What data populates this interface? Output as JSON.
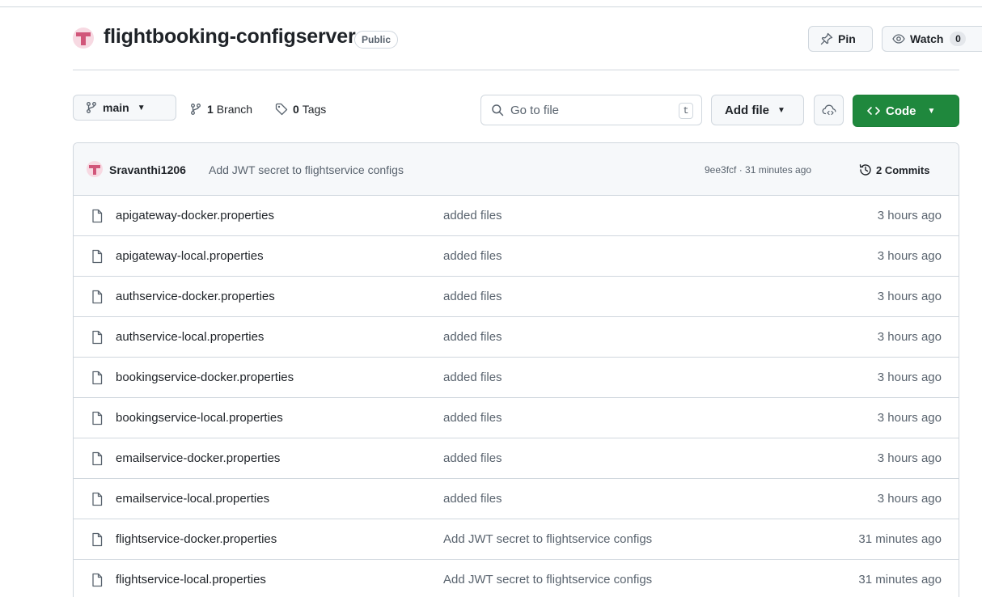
{
  "repo": {
    "name": "flightbooking-configserver",
    "visibility": "Public"
  },
  "actions": {
    "pin_label": "Pin",
    "watch_label": "Watch",
    "watch_count": "0"
  },
  "toolbar": {
    "branch": "main",
    "branches_count": "1",
    "branches_label": "Branch",
    "tags_count": "0",
    "tags_label": "Tags",
    "search_placeholder": "Go to file",
    "search_shortcut": "t",
    "add_file_label": "Add file",
    "code_label": "Code"
  },
  "latest_commit": {
    "author": "Sravanthi1206",
    "message": "Add JWT secret to flightservice configs",
    "hash_time": "9ee3fcf · 31 minutes ago",
    "commits_label": "2 Commits"
  },
  "files": [
    {
      "name": "apigateway-docker.properties",
      "message": "added files",
      "age": "3 hours ago"
    },
    {
      "name": "apigateway-local.properties",
      "message": "added files",
      "age": "3 hours ago"
    },
    {
      "name": "authservice-docker.properties",
      "message": "added files",
      "age": "3 hours ago"
    },
    {
      "name": "authservice-local.properties",
      "message": "added files",
      "age": "3 hours ago"
    },
    {
      "name": "bookingservice-docker.properties",
      "message": "added files",
      "age": "3 hours ago"
    },
    {
      "name": "bookingservice-local.properties",
      "message": "added files",
      "age": "3 hours ago"
    },
    {
      "name": "emailservice-docker.properties",
      "message": "added files",
      "age": "3 hours ago"
    },
    {
      "name": "emailservice-local.properties",
      "message": "added files",
      "age": "3 hours ago"
    },
    {
      "name": "flightservice-docker.properties",
      "message": "Add JWT secret to flightservice configs",
      "age": "31 minutes ago"
    },
    {
      "name": "flightservice-local.properties",
      "message": "Add JWT secret to flightservice configs",
      "age": "31 minutes ago"
    }
  ],
  "colors": {
    "accent_green": "#1f883d",
    "avatar_pink": "#d1567a",
    "muted_text": "#59636e",
    "border": "#d0d7de"
  }
}
